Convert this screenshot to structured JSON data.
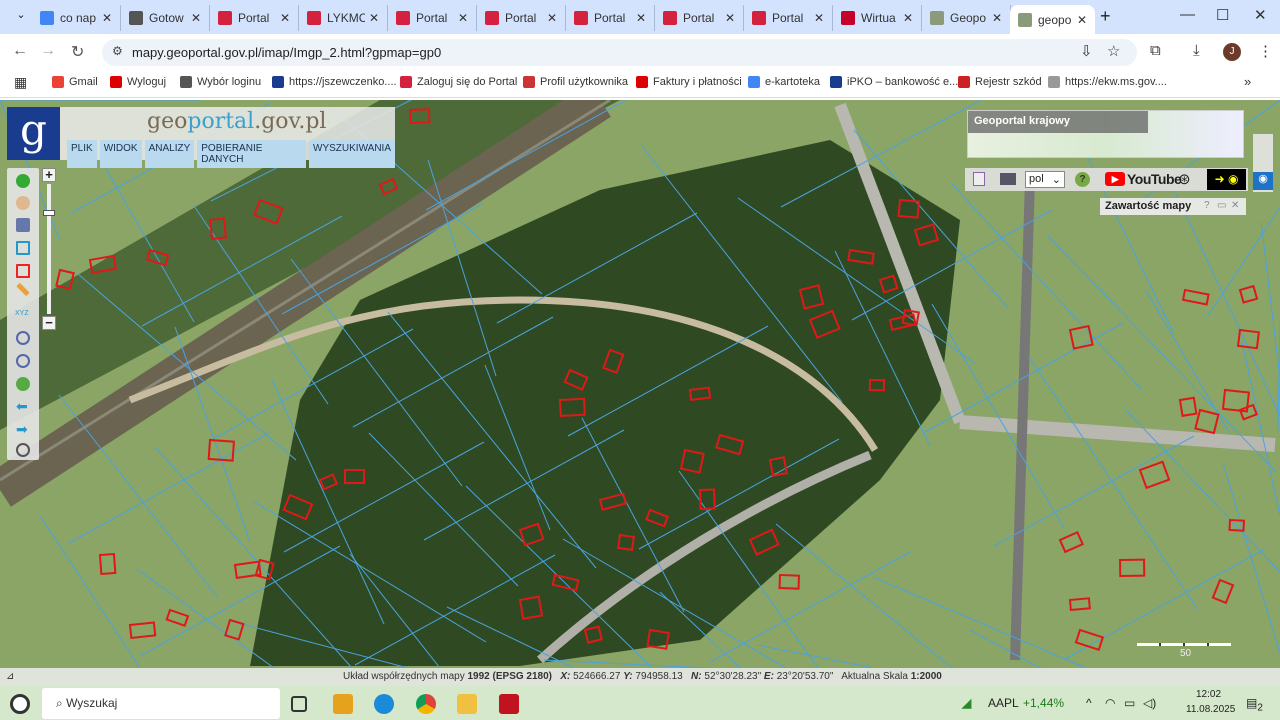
{
  "browser": {
    "tabs": [
      {
        "title": "co nap",
        "color": "#4285f4"
      },
      {
        "title": "Gotow",
        "color": "#555"
      },
      {
        "title": "Portal",
        "color": "#d4213d"
      },
      {
        "title": "LYKMC",
        "color": "#d4213d"
      },
      {
        "title": "Portal",
        "color": "#d4213d"
      },
      {
        "title": "Portal",
        "color": "#d4213d"
      },
      {
        "title": "Portal",
        "color": "#d4213d"
      },
      {
        "title": "Portal",
        "color": "#d4213d"
      },
      {
        "title": "Portal",
        "color": "#d4213d"
      },
      {
        "title": "Wirtua",
        "color": "#c4002b"
      },
      {
        "title": "Geopo",
        "color": "#8a9a7a"
      },
      {
        "title": "geopo",
        "color": "#8a9a7a"
      }
    ],
    "url": "mapy.geoportal.gov.pl/imap/Imgp_2.html?gpmap=gp0",
    "avatar": "J",
    "bookmarks": [
      "Gmail",
      "Wyloguj",
      "Wybór loginu",
      "https://jszewczenko....",
      "Zaloguj się do Portal",
      "Profil użytkownika",
      "Faktury i płatności",
      "e-kartoteka",
      "iPKO – bankowość e...",
      "Rejestr szkód",
      "https://ekw.ms.gov...."
    ]
  },
  "geoportal": {
    "logo_letter": "g",
    "title_a": "geo",
    "title_b": "portal",
    "title_c": ".gov.pl",
    "menu": [
      "PLIK",
      "WIDOK",
      "ANALIZY",
      "POBIERANIE DANYCH",
      "WYSZUKIWANIA"
    ],
    "krajowy": "Geoportal krajowy",
    "language": "pol",
    "youtube": "YouTube",
    "panel_title": "Zawartość mapy",
    "scale_label": "50"
  },
  "status": {
    "label": "Układ współrzędnych mapy",
    "system": "1992 (EPSG 2180)",
    "x_label": "X:",
    "x": "524666.27",
    "y_label": "Y:",
    "y": "794958.13",
    "n_label": "N:",
    "n": "52°30'28.23\"",
    "e_label": "E:",
    "e": "23°20'53.70\"",
    "scale_label": "Aktualna Skala",
    "scale": "1:2000"
  },
  "taskbar": {
    "search": "Wyszukaj",
    "stock": "AAPL",
    "stock_change": "+1,44%",
    "time": "12:02",
    "date": "11.08.2025",
    "notifications": "2"
  }
}
